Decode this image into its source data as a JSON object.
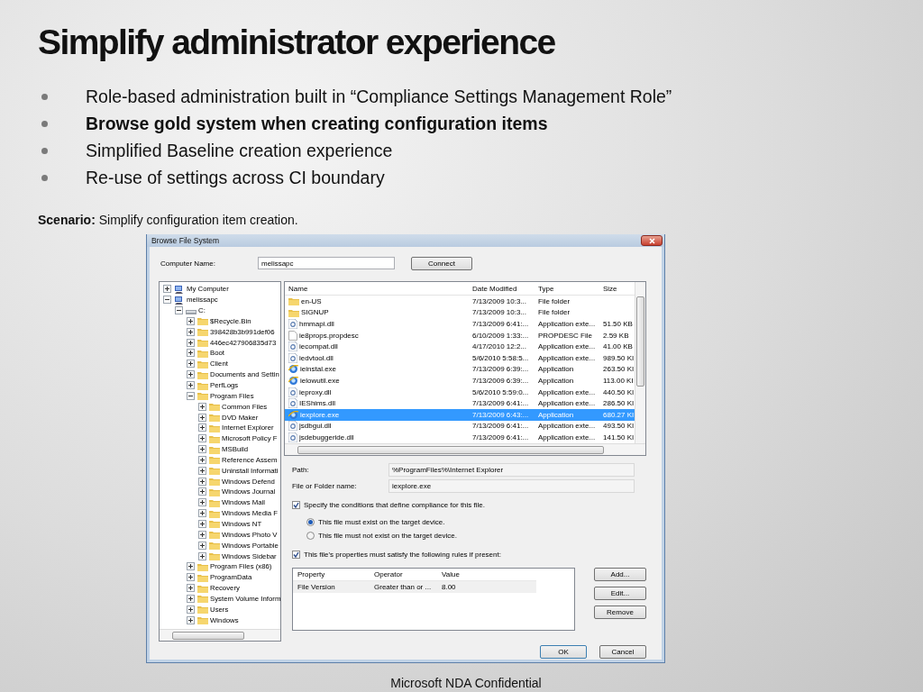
{
  "slide": {
    "title": "Simplify administrator experience",
    "bullets": [
      {
        "text": "Role-based administration built in “Compliance Settings Management Role”",
        "bold": false
      },
      {
        "text": "Browse gold system when creating configuration items",
        "bold": true
      },
      {
        "text": "Simplified Baseline creation experience",
        "bold": false
      },
      {
        "text": "Re-use of settings across CI boundary",
        "bold": false
      }
    ],
    "scenario": "**Scenario:** Simplify configuration item creation.",
    "footer": "Microsoft NDA Confidential"
  },
  "dialog": {
    "title": "Browse File System",
    "computer_label": "Computer Name:",
    "computer_value": "melissapc",
    "connect": "Connect",
    "tree": [
      {
        "label": "My Computer",
        "kind": "computer",
        "expanded": false
      },
      {
        "label": "melissapc",
        "kind": "computer",
        "expanded": true,
        "children": [
          {
            "label": "C:",
            "kind": "drive",
            "expanded": true,
            "children": [
              {
                "label": "$Recycle.Bin",
                "kind": "folder",
                "expanded": false
              },
              {
                "label": "398428b3b991def06",
                "kind": "folder",
                "expanded": false
              },
              {
                "label": "446ec427906835d73",
                "kind": "folder",
                "expanded": false
              },
              {
                "label": "Boot",
                "kind": "folder",
                "expanded": false
              },
              {
                "label": "Client",
                "kind": "folder",
                "expanded": false
              },
              {
                "label": "Documents and Settin",
                "kind": "folder",
                "expanded": false
              },
              {
                "label": "PerfLogs",
                "kind": "folder",
                "expanded": false
              },
              {
                "label": "Program Files",
                "kind": "folder",
                "expanded": true,
                "children": [
                  {
                    "label": "Common Files",
                    "kind": "folder",
                    "expanded": false
                  },
                  {
                    "label": "DVD Maker",
                    "kind": "folder",
                    "expanded": false
                  },
                  {
                    "label": "Internet Explorer",
                    "kind": "folder",
                    "expanded": false
                  },
                  {
                    "label": "Microsoft Policy F",
                    "kind": "folder",
                    "expanded": false
                  },
                  {
                    "label": "MSBuild",
                    "kind": "folder",
                    "expanded": false
                  },
                  {
                    "label": "Reference Assem",
                    "kind": "folder",
                    "expanded": false
                  },
                  {
                    "label": "Uninstall Informati",
                    "kind": "folder",
                    "expanded": false
                  },
                  {
                    "label": "Windows Defend",
                    "kind": "folder",
                    "expanded": false
                  },
                  {
                    "label": "Windows Journal",
                    "kind": "folder",
                    "expanded": false
                  },
                  {
                    "label": "Windows Mail",
                    "kind": "folder",
                    "expanded": false
                  },
                  {
                    "label": "Windows Media F",
                    "kind": "folder",
                    "expanded": false
                  },
                  {
                    "label": "Windows NT",
                    "kind": "folder",
                    "expanded": false
                  },
                  {
                    "label": "Windows Photo V",
                    "kind": "folder",
                    "expanded": false
                  },
                  {
                    "label": "Windows Portable",
                    "kind": "folder",
                    "expanded": false
                  },
                  {
                    "label": "Windows Sidebar",
                    "kind": "folder",
                    "expanded": false
                  }
                ]
              },
              {
                "label": "Program Files (x86)",
                "kind": "folder",
                "expanded": false
              },
              {
                "label": "ProgramData",
                "kind": "folder",
                "expanded": false
              },
              {
                "label": "Recovery",
                "kind": "folder",
                "expanded": false
              },
              {
                "label": "System Volume Inform",
                "kind": "folder",
                "expanded": false
              },
              {
                "label": "Users",
                "kind": "folder",
                "expanded": false
              },
              {
                "label": "Windows",
                "kind": "folder",
                "expanded": false
              }
            ]
          }
        ]
      }
    ],
    "files": {
      "columns": [
        "Name",
        "Date Modified",
        "Type",
        "Size"
      ],
      "rows": [
        {
          "kind": "folder",
          "cells": [
            "en-US",
            "7/13/2009 10:3...",
            "File folder"
          ],
          "selected": false
        },
        {
          "kind": "folder",
          "cells": [
            "SIGNUP",
            "7/13/2009 10:3...",
            "File folder"
          ],
          "selected": false
        },
        {
          "kind": "dll",
          "cells": [
            "hmmapi.dll",
            "7/13/2009 6:41:...",
            "Application exte...",
            "51.50 KB"
          ],
          "selected": false
        },
        {
          "kind": "file",
          "cells": [
            "ie8props.propdesc",
            "6/10/2009 1:33:...",
            "PROPDESC File",
            "2.59 KB"
          ],
          "selected": false
        },
        {
          "kind": "dll",
          "cells": [
            "iecompat.dll",
            "4/17/2010 12:2...",
            "Application exte...",
            "41.00 KB"
          ],
          "selected": false
        },
        {
          "kind": "dll",
          "cells": [
            "iedvtool.dll",
            "5/6/2010 5:58:5...",
            "Application exte...",
            "989.50 KI"
          ],
          "selected": false
        },
        {
          "kind": "app",
          "cells": [
            "ieinstal.exe",
            "7/13/2009 6:39:...",
            "Application",
            "263.50 KI"
          ],
          "selected": false
        },
        {
          "kind": "app",
          "cells": [
            "ielowutil.exe",
            "7/13/2009 6:39:...",
            "Application",
            "113.00 KI"
          ],
          "selected": false
        },
        {
          "kind": "dll",
          "cells": [
            "ieproxy.dll",
            "5/6/2010 5:59:0...",
            "Application exte...",
            "440.50 KI"
          ],
          "selected": false
        },
        {
          "kind": "dll",
          "cells": [
            "IEShims.dll",
            "7/13/2009 6:41:...",
            "Application exte...",
            "286.50 KI"
          ],
          "selected": false
        },
        {
          "kind": "app",
          "cells": [
            "iexplore.exe",
            "7/13/2009 6:43:...",
            "Application",
            "680.27 KI"
          ],
          "selected": true
        },
        {
          "kind": "dll",
          "cells": [
            "jsdbgui.dll",
            "7/13/2009 6:41:...",
            "Application exte...",
            "493.50 KI"
          ],
          "selected": false
        },
        {
          "kind": "dll",
          "cells": [
            "jsdebuggeride.dll",
            "7/13/2009 6:41:...",
            "Application exte...",
            "141.50 KI"
          ],
          "selected": false
        }
      ]
    },
    "path_label": "Path:",
    "path_value": "%ProgramFiles%\\Internet Explorer",
    "name_label": "File or Folder name:",
    "name_value": "iexplore.exe",
    "specify": {
      "label": "Specify the conditions that define compliance for this file.",
      "checked": true
    },
    "radios": [
      {
        "label": "This file must exist on the target device.",
        "selected": true
      },
      {
        "label": "This file must not exist on the target device.",
        "selected": false
      }
    ],
    "rules_check": {
      "label": "This file's properties must satisfy the following rules if present:",
      "checked": true
    },
    "rules": {
      "columns": [
        "Property",
        "Operator",
        "Value"
      ],
      "rows": [
        [
          "File Version",
          "Greater than or ...",
          "8.00"
        ]
      ]
    },
    "side_buttons": [
      "Add...",
      "Edit...",
      "Remove"
    ],
    "buttons": [
      "OK",
      "Cancel"
    ]
  }
}
